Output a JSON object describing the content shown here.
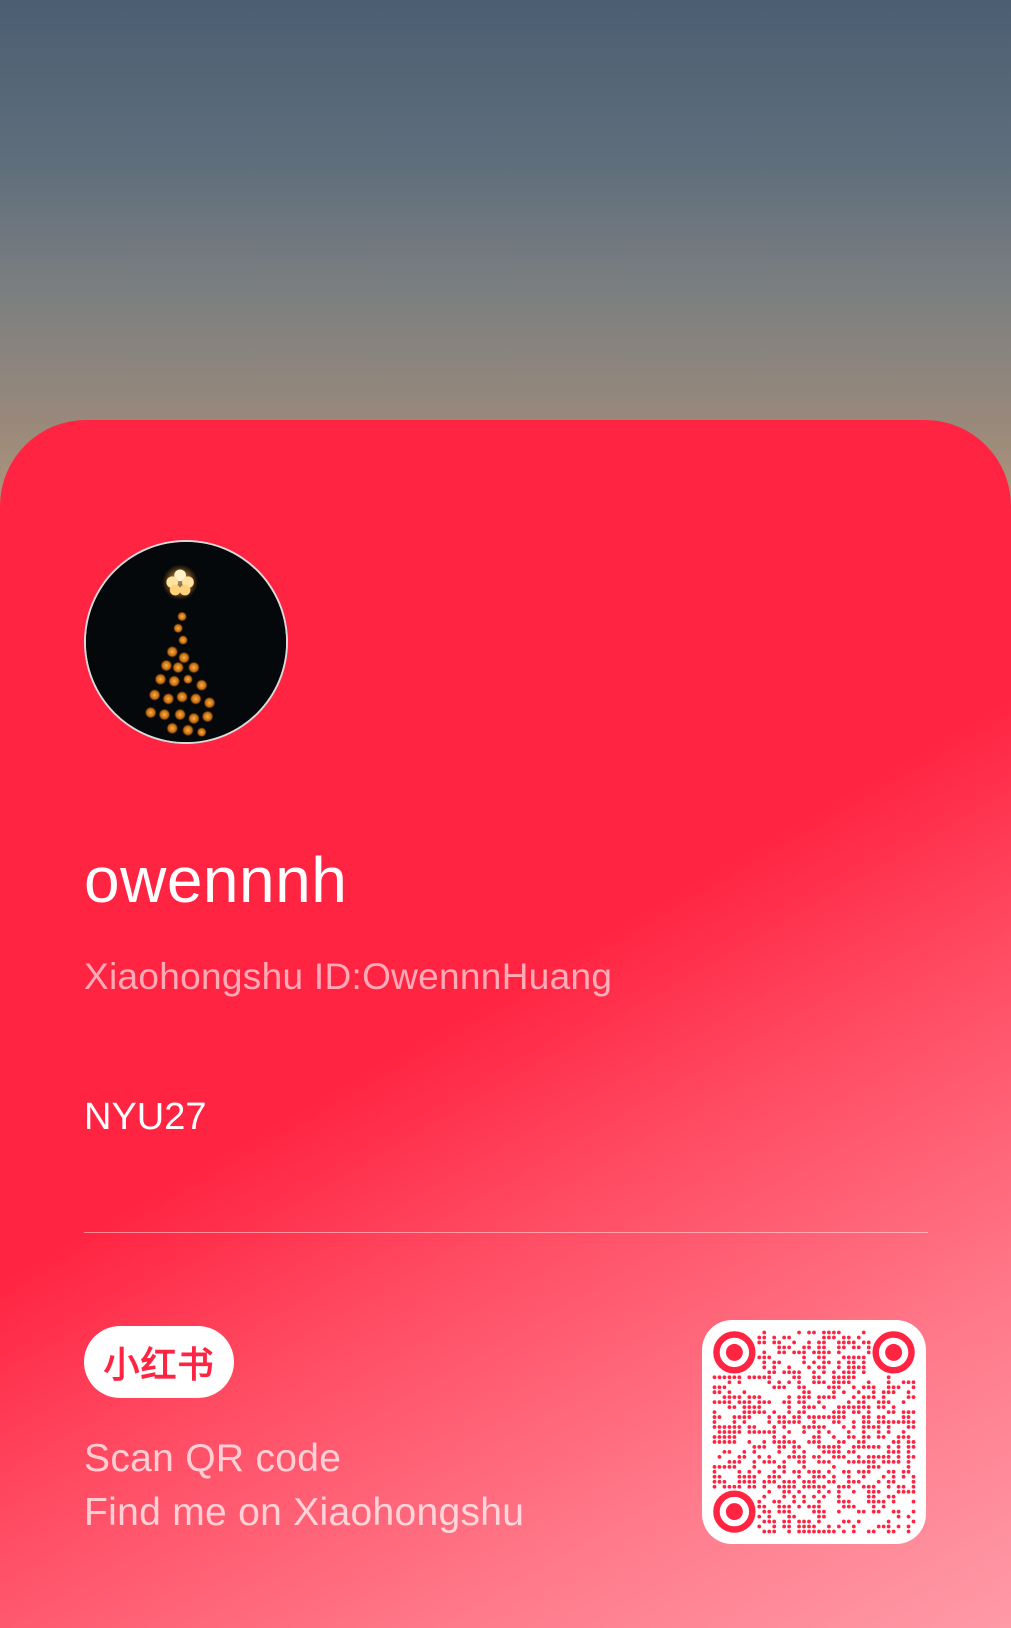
{
  "profile": {
    "username": "owennnh",
    "id_line": "Xiaohongshu ID:OwennnHuang",
    "bio": "NYU27"
  },
  "brand": {
    "logo_text": "小红书",
    "accent_color": "#ff2442"
  },
  "footer": {
    "line1": "Scan QR code",
    "line2": "Find me on Xiaohongshu"
  }
}
